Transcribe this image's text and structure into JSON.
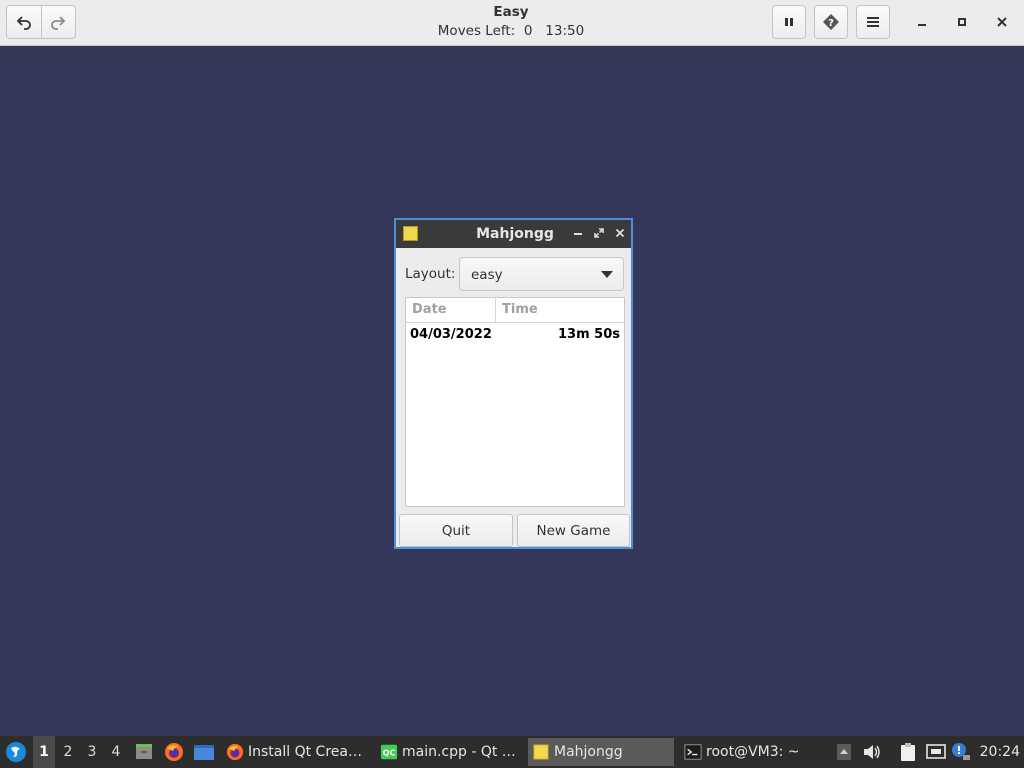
{
  "header": {
    "title": "Easy",
    "subtitle": "Moves Left:  0   13:50",
    "undo_icon": "undo-icon",
    "redo_icon": "redo-icon",
    "pause_icon": "pause-icon",
    "hint_icon": "hint-icon",
    "menu_icon": "menu-icon"
  },
  "dialog": {
    "title": "Mahjongg",
    "layout_label": "Layout:",
    "layout_value": "easy",
    "columns": [
      "Date",
      "Time"
    ],
    "rows": [
      {
        "date": "04/03/2022",
        "time": "13m 50s"
      }
    ],
    "quit_label": "Quit",
    "new_game_label": "New Game"
  },
  "taskbar": {
    "workspaces": [
      "1",
      "2",
      "3",
      "4"
    ],
    "active_workspace": "1",
    "tasks": [
      {
        "label": "Install Qt Crea…",
        "icon": "firefox-icon"
      },
      {
        "label": "main.cpp - Qt …",
        "icon": "qt-creator-icon"
      },
      {
        "label": "Mahjongg",
        "icon": "mahjongg-icon",
        "active": true
      },
      {
        "label": "root@VM3: ~",
        "icon": "terminal-icon"
      }
    ],
    "clock": "20:24"
  },
  "colors": {
    "desktop": "#35375a",
    "accent": "#4a90d9",
    "taskbar": "#2d2d2d"
  }
}
